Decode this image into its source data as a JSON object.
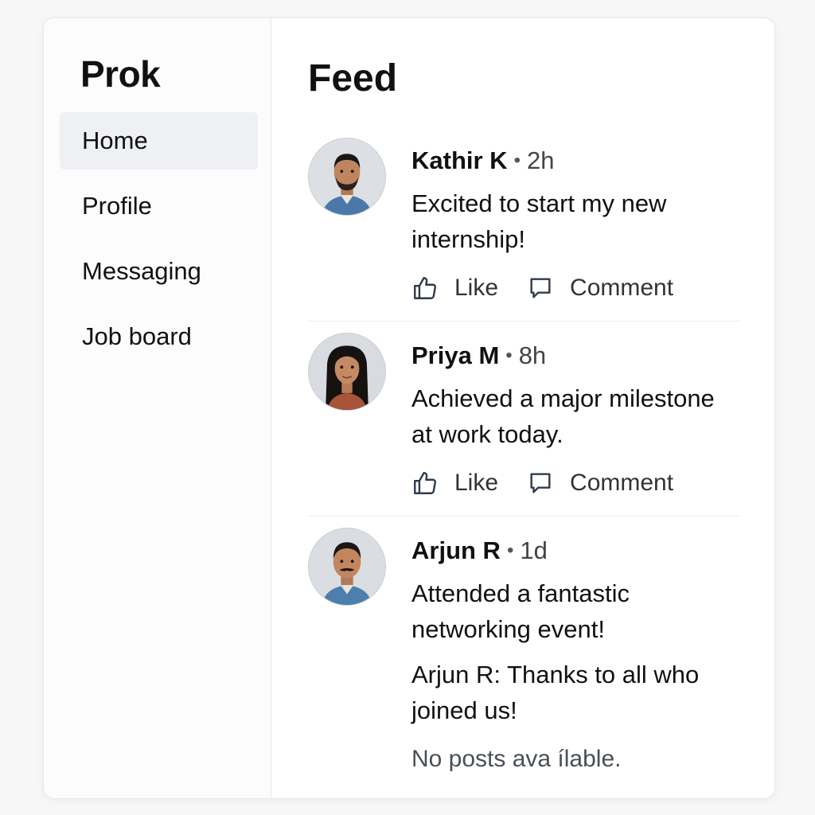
{
  "sidebar": {
    "brand": "Prok",
    "items": [
      {
        "label": "Home",
        "active": true
      },
      {
        "label": "Profile",
        "active": false
      },
      {
        "label": "Messaging",
        "active": false
      },
      {
        "label": "Job board",
        "active": false
      }
    ]
  },
  "feed": {
    "title": "Feed",
    "posts": [
      {
        "author": "Kathir K",
        "separator": "•",
        "time": "2h",
        "text": "Excited to start my new internship!",
        "like_label": "Like",
        "comment_label": "Comment"
      },
      {
        "author": "Priya M",
        "separator": "•",
        "time": "8h",
        "text": "Achieved a major milestone at work today.",
        "like_label": "Like",
        "comment_label": "Comment"
      },
      {
        "author": "Arjun R",
        "separator": "•",
        "time": "1d",
        "text": "Attended a fantastic networking event!",
        "reply": "Arjun R: Thanks to all who joined us!"
      }
    ],
    "empty_message": "No posts ava ílable."
  },
  "icons": {
    "like": "thumbs-up-icon",
    "comment": "speech-bubble-icon",
    "avatar": "user-avatar"
  },
  "colors": {
    "accent_bg": "#eef0f3",
    "border": "#e6e8eb"
  }
}
